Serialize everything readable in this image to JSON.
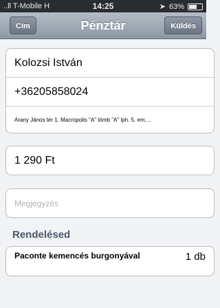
{
  "status": {
    "carrier": "..ll T-Mobile H",
    "time": "14:25",
    "battery": "63%",
    "battery_level": 0.63
  },
  "nav": {
    "title": "Pénztár",
    "back_label": "Cím",
    "send_label": "Küldés"
  },
  "contact": {
    "name": "Kolozsi István",
    "phone": "+36205858024",
    "address": "Arany János tér 1. Macropolis \"A\" tömb \"A\" lph. 5. em...."
  },
  "price": "1 290 Ft",
  "note": {
    "placeholder": "Megjegyzés",
    "value": ""
  },
  "order": {
    "section_title": "Rendelésed",
    "items": [
      {
        "name": "Paconte kemencés burgonyával",
        "qty": "1 db"
      }
    ]
  }
}
